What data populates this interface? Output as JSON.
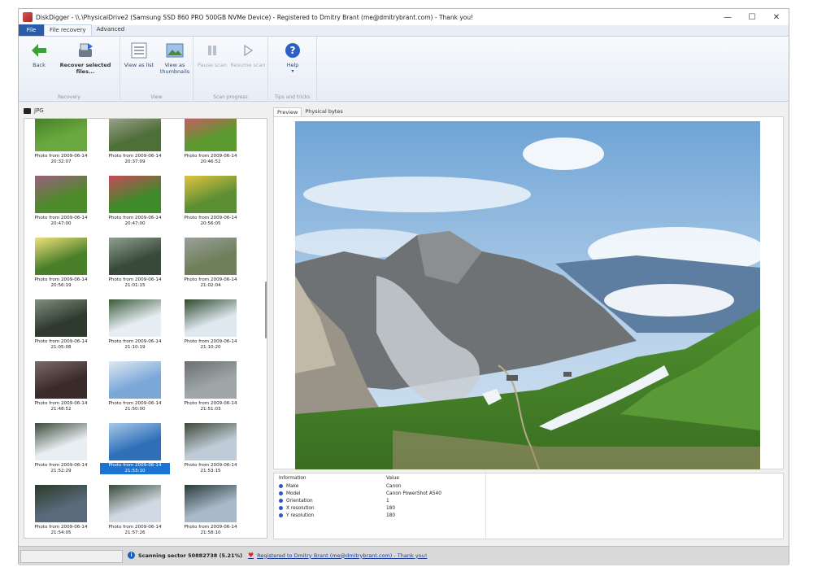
{
  "window": {
    "title": "DiskDigger - \\\\.\\PhysicalDrive2 (Samsung SSD 860 PRO 500GB NVMe Device) - Registered to Dmitry Brant (me@dmitrybrant.com) - Thank you!",
    "controls": [
      "—",
      "☐",
      "✕"
    ]
  },
  "ribbon": {
    "file_tab": "File",
    "tabs": [
      "File recovery",
      "Advanced"
    ],
    "groups": [
      {
        "label": "Recovery",
        "buttons": [
          {
            "label": "Back",
            "icon": "back-arrow-icon"
          },
          {
            "label": "Recover selected files...",
            "icon": "recover-icon"
          }
        ]
      },
      {
        "label": "View",
        "buttons": [
          {
            "label": "View as list",
            "icon": "list-icon"
          },
          {
            "label": "View as thumbnails",
            "icon": "thumbnails-icon"
          }
        ]
      },
      {
        "label": "Scan progress",
        "buttons": [
          {
            "label": "Pause scan",
            "icon": "pause-icon"
          },
          {
            "label": "Resume scan",
            "icon": "play-icon"
          }
        ]
      },
      {
        "label": "Tips and tricks",
        "buttons": [
          {
            "label": "Help",
            "icon": "help-icon"
          }
        ]
      }
    ]
  },
  "left_panel": {
    "folder": "JPG",
    "thumbnails": [
      {
        "caption": "Photo from 2009-06-14 20:32:07"
      },
      {
        "caption": "Photo from 2009-06-14 20:37:09"
      },
      {
        "caption": "Photo from 2009-06-14 20:46:52"
      },
      {
        "caption": "Photo from 2009-06-14 20:47:00"
      },
      {
        "caption": "Photo from 2009-06-14 20:47:00"
      },
      {
        "caption": "Photo from 2009-06-14 20:56:05"
      },
      {
        "caption": "Photo from 2009-06-14 20:56:19"
      },
      {
        "caption": "Photo from 2009-06-14 21:01:15"
      },
      {
        "caption": "Photo from 2009-06-14 21:02:04"
      },
      {
        "caption": "Photo from 2009-06-14 21:05:08"
      },
      {
        "caption": "Photo from 2009-06-14 21:10:19"
      },
      {
        "caption": "Photo from 2009-06-14 21:10:20"
      },
      {
        "caption": "Photo from 2009-06-14 21:48:52"
      },
      {
        "caption": "Photo from 2009-06-14 21:50:00"
      },
      {
        "caption": "Photo from 2009-06-14 21:51:03"
      },
      {
        "caption": "Photo from 2009-06-14 21:52:29"
      },
      {
        "caption": "Photo from 2009-06-14 21:53:10"
      },
      {
        "caption": "Photo from 2009-06-14 21:53:15"
      },
      {
        "caption": "Photo from 2009-06-14 21:54:05"
      },
      {
        "caption": "Photo from 2009-06-14 21:57:26"
      },
      {
        "caption": "Photo from 2009-06-14 21:58:10"
      }
    ],
    "selected_index": 16
  },
  "preview": {
    "tabs": [
      "Preview",
      "Physical bytes"
    ]
  },
  "info_table": {
    "headers": [
      "Information",
      "Value"
    ],
    "rows": [
      {
        "key": "Make",
        "value": "Canon"
      },
      {
        "key": "Model",
        "value": "Canon PowerShot A540"
      },
      {
        "key": "Orientation",
        "value": "1"
      },
      {
        "key": "X resolution",
        "value": "180"
      },
      {
        "key": "Y resolution",
        "value": "180"
      }
    ]
  },
  "statusbar": {
    "scanning": "Scanning sector 50882738 (5.21%)",
    "registration": "Registered to Dmitry Brant (me@dmitrybrant.com) - Thank you!"
  },
  "colors": {
    "file_tab": "#2a5ca8",
    "selection": "#1b74d3",
    "accent_link": "#1a3c9a"
  }
}
